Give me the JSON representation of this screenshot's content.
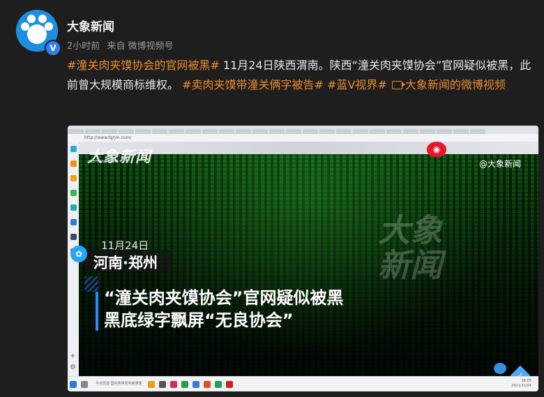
{
  "author": {
    "name": "大象新闻",
    "verified_mark": "V"
  },
  "meta": {
    "time": "2小时前",
    "source": "来自 微博视频号"
  },
  "post": {
    "tag1": "#潼关肉夹馍协会的官网被黑#",
    "text1": " 11月24日陕西渭南。陕西“潼关肉夹馍协会”官网疑似被黑，此前曾大规模商标维权。",
    "tag2": "#卖肉夹馍带潼关俩字被告#",
    "tag3": "#蓝V视界#",
    "video_link": "大象新闻的微博视频"
  },
  "video": {
    "browser_url": "http://www.tgrjm.com/",
    "watermark_logo": "大象新闻",
    "watermark_sub": "ELEPHANT NEWS",
    "weibo_handle": "@大象新闻",
    "big_watermark": "大象\n新闻",
    "date": "11月24日",
    "location": "河南·郑州",
    "headline_line1": "“潼关肉夹馍协会”官网疑似被黑",
    "headline_line2": "黑底绿字飘屏“无良协会”",
    "taskbar_text": "今日优选  国内男排发布新赛季",
    "clock_time": "16:05",
    "clock_date": "2021/11/24"
  },
  "colors": {
    "tag": "#ee8b2f",
    "background": "#1e1e1e",
    "matrix_green": "#0f5a12",
    "accent_blue": "#2e88ff"
  }
}
